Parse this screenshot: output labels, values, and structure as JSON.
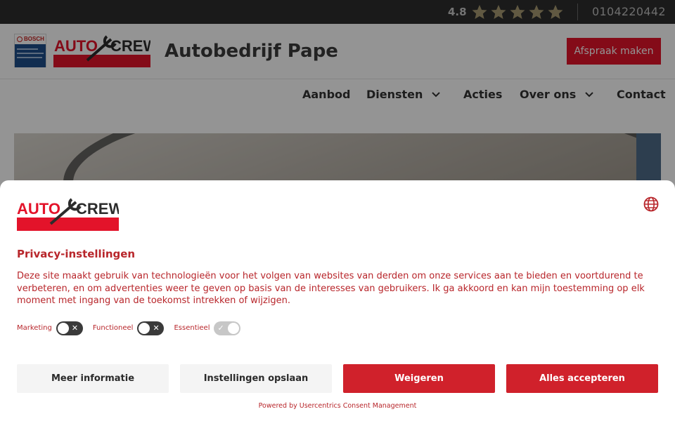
{
  "topbar": {
    "rating": "4.8",
    "star_count": 5,
    "star_color": "#a89a72",
    "phone": "0104220442"
  },
  "header": {
    "bosch_logo_text": "BOSCH",
    "autocrew_logo_text": "AUTO CREW",
    "site_title": "Autobedrijf Pape",
    "cta_label": "Afspraak maken",
    "brand_red": "#e3132a"
  },
  "nav": {
    "items": [
      {
        "label": "Aanbod",
        "has_dropdown": false
      },
      {
        "label": "Diensten",
        "has_dropdown": true
      },
      {
        "label": "Acties",
        "has_dropdown": false
      },
      {
        "label": "Over ons",
        "has_dropdown": true
      },
      {
        "label": "Contact",
        "has_dropdown": false
      }
    ]
  },
  "consent": {
    "logo_text": "AUTO CREW",
    "language_icon": "globe-icon",
    "title": "Privacy-instellingen",
    "body": "Deze site maakt gebruik van technologieën voor het volgen van websites van derden om onze services aan te bieden en voortdurend te verbeteren, en om advertenties weer te geven op basis van de interesses van gebruikers. Ik ga akkoord en kan mijn toestemming op elk moment met ingang van de toekomst intrekken of wijzigen.",
    "toggles": [
      {
        "label": "Marketing",
        "enabled": false,
        "locked": false
      },
      {
        "label": "Functioneel",
        "enabled": false,
        "locked": false
      },
      {
        "label": "Essentieel",
        "enabled": true,
        "locked": true
      }
    ],
    "buttons": {
      "more_info": "Meer informatie",
      "save_settings": "Instellingen opslaan",
      "deny": "Weigeren",
      "accept_all": "Alles accepteren"
    },
    "powered_by": "Powered by Usercentrics Consent Management",
    "accent_color": "#d0212b",
    "text_color": "#b8262b"
  }
}
